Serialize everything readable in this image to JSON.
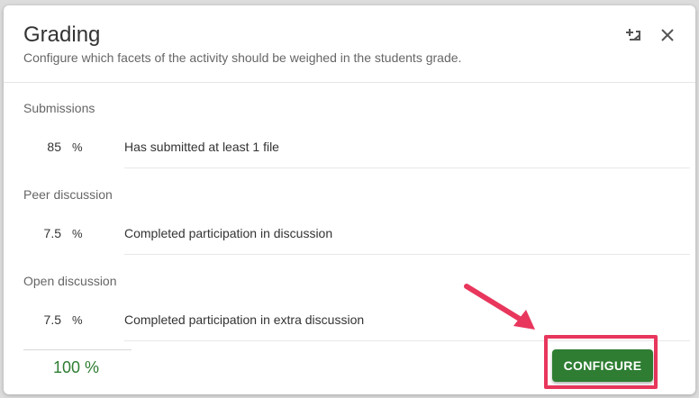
{
  "dialog": {
    "title": "Grading",
    "subtitle": "Configure which facets of the activity should be weighed in the students grade."
  },
  "header_icons": {
    "add": "add-note-icon",
    "close": "close-icon"
  },
  "sections": [
    {
      "label": "Submissions",
      "value": "85",
      "unit": "%",
      "description": "Has submitted at least 1 file"
    },
    {
      "label": "Peer discussion",
      "value": "7.5",
      "unit": "%",
      "description": "Completed participation in discussion"
    },
    {
      "label": "Open discussion",
      "value": "7.5",
      "unit": "%",
      "description": "Completed participation in extra discussion"
    }
  ],
  "total": "100 %",
  "configure_label": "CONFIGURE",
  "colors": {
    "primary": "#2e7d32",
    "highlight": "#e8365c",
    "arrow": "#e8365c"
  }
}
